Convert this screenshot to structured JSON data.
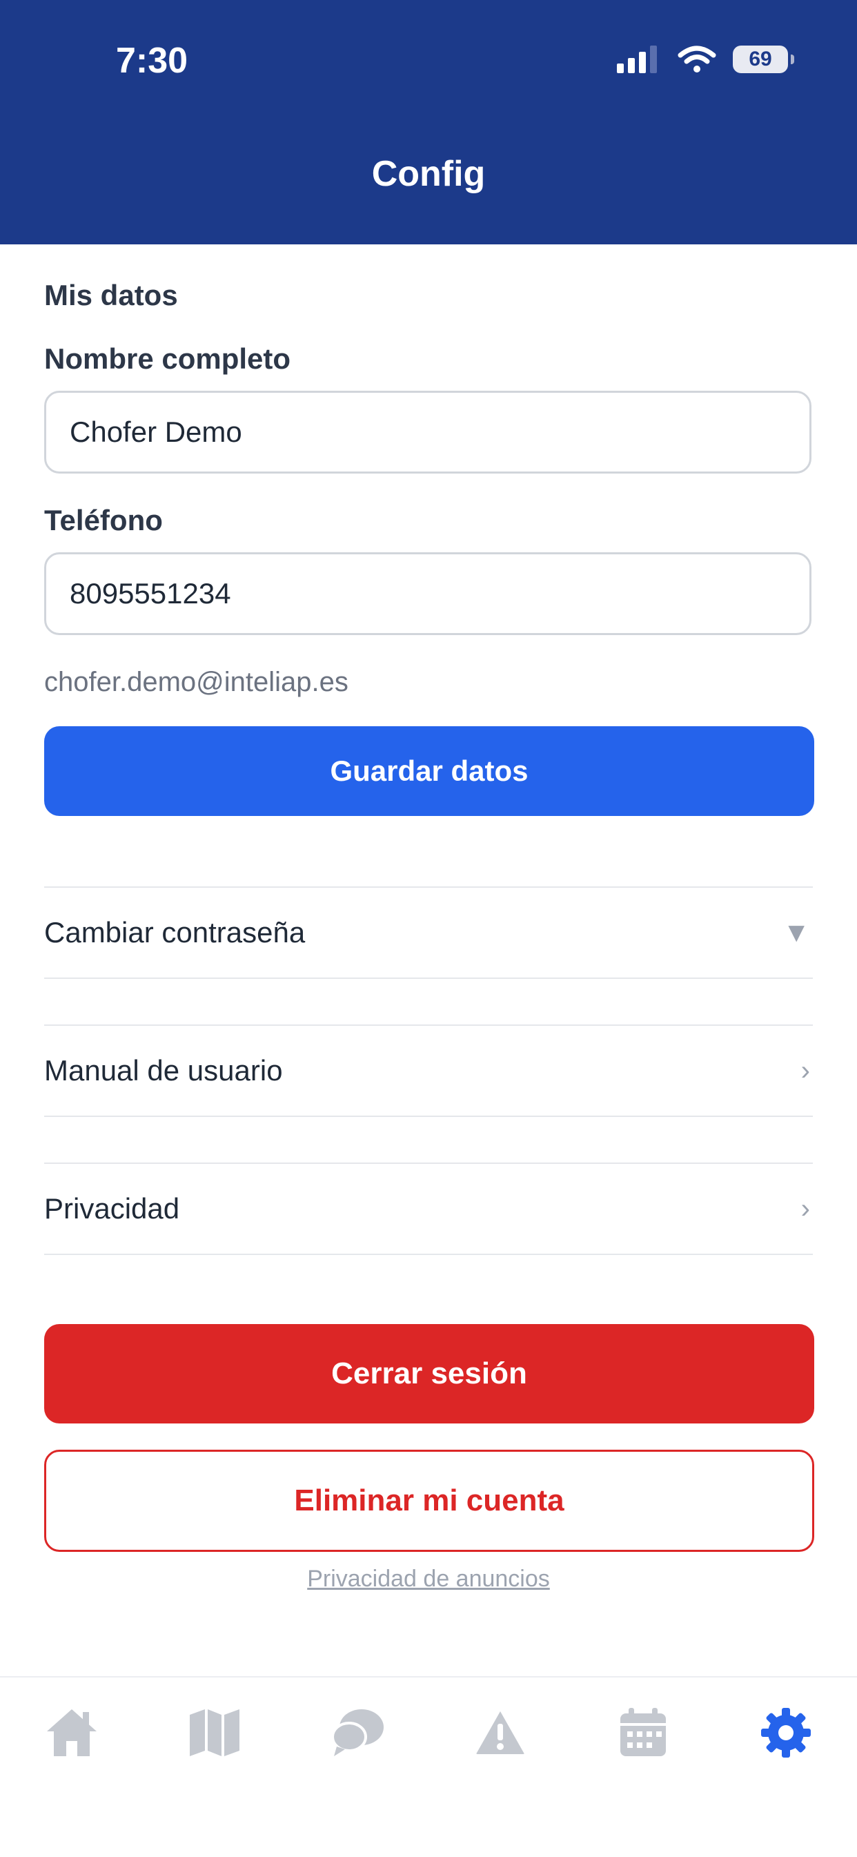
{
  "status_bar": {
    "time": "7:30",
    "battery": "69"
  },
  "header": {
    "title": "Config"
  },
  "profile": {
    "section_title": "Mis datos",
    "name_label": "Nombre completo",
    "name_value": "Chofer Demo",
    "phone_label": "Teléfono",
    "phone_value": "8095551234",
    "email": "chofer.demo@inteliap.es",
    "save_label": "Guardar datos"
  },
  "menu": {
    "change_password": "Cambiar contraseña",
    "change_password_arrow": "▼",
    "manual": "Manual de usuario",
    "manual_arrow": "›",
    "privacy": "Privacidad",
    "privacy_arrow": "›"
  },
  "actions": {
    "logout": "Cerrar sesión",
    "delete_account": "Eliminar mi cuenta",
    "ads_privacy": "Privacidad de anuncios"
  },
  "tabbar": {
    "items": [
      {
        "icon": "home-icon",
        "active": false
      },
      {
        "icon": "map-icon",
        "active": false
      },
      {
        "icon": "chat-icon",
        "active": false
      },
      {
        "icon": "alert-icon",
        "active": false
      },
      {
        "icon": "calendar-icon",
        "active": false
      },
      {
        "icon": "gear-icon",
        "active": true
      }
    ],
    "active_color": "#2563eb",
    "inactive_color": "#c4c8cf"
  },
  "colors": {
    "header": "#1c3a8a",
    "primary": "#2563eb",
    "danger": "#dc2626"
  }
}
